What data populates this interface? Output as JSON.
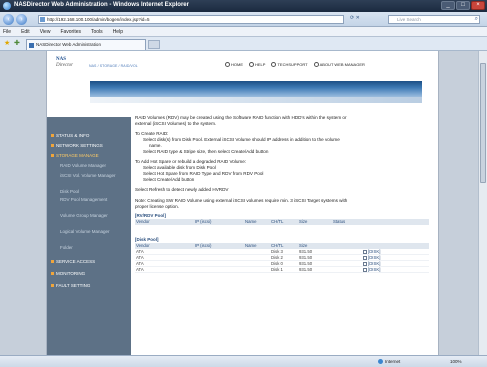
{
  "window": {
    "title": "NASDirector Web Administration - Windows Internet Explorer"
  },
  "nav": {
    "address": "http://192.168.100.100/admin/bogen/index.jsp?id=5",
    "search_placeholder": "Live Search",
    "menu": [
      "File",
      "Edit",
      "View",
      "Favorites",
      "Tools",
      "Help"
    ],
    "tab_title": "NASDirector Web Administration"
  },
  "header": {
    "logo_line1": "NAS",
    "logo_line2": "Director",
    "breadcrumb": "NAS / STORAGE / RAID/VOL",
    "links": [
      "HOME",
      "HELP",
      "TECHSUPPORT",
      "ABOUT WEB MANAGER"
    ]
  },
  "sidebar": {
    "items": [
      {
        "label": "STATUS & INFO",
        "hot": false
      },
      {
        "label": "NETWORK SETTINGS",
        "hot": false
      },
      {
        "label": "STORAGE MANAGE",
        "hot": true
      }
    ],
    "subitems": [
      "RAID Volume Manager",
      "iSCSI Vol. Volume Manager",
      "Disk Pool",
      "RDV Pool Management",
      "Volume Group Manager",
      "Logical Volume Manager",
      "Folder"
    ],
    "bottom_items": [
      "SERVICE ACCESS",
      "MONITORING",
      "FAULT SETTING"
    ]
  },
  "content": {
    "intro1": "RAID Volumes (RDV) may be created using the Software RAID function with HDD's within the system or",
    "intro2": "external (iSCSI Volumes) to the system.",
    "create_head": "To Create RAID:",
    "create_1": "Select disk(s) from Disk Pool. External iSCSI Volume should IP address in addition to the volume",
    "create_1b": "name.",
    "create_2": "Select RAID type & Stripe size, then select Create/Add button",
    "hot_head": "To Add Hot Spare or rebuild a degraded RAID Volume:",
    "hot_1": "Select available disk from Disk Pool",
    "hot_2": "Select Hot Spare from RAID Type and RDV from RDV Pool",
    "hot_3": "Select Create/Add button",
    "refresh": "Select Refresh to detect newly added HVRDV",
    "note": "Note: Creating SW RAID Volume using external iSCSI volumes require min. 3 iSCSI Target systems with",
    "note2": "proper license option."
  },
  "rdv_pool": {
    "caption": "[RV/RDV Pool]",
    "columns": [
      "Vendor",
      "IP (iscsi)",
      "Name",
      "CH/TL",
      "Size",
      "Status"
    ]
  },
  "disk_pool": {
    "caption": "[Disk Pool]",
    "columns": [
      "Vendor",
      "IP (iscsi)",
      "Name",
      "CH/TL",
      "Size"
    ],
    "rows": [
      {
        "vendor": "ATA",
        "ch": "Disk 3",
        "size": "931.50",
        "flag": "[DISK]"
      },
      {
        "vendor": "ATA",
        "ch": "Disk 2",
        "size": "931.50",
        "flag": "[DISK]"
      },
      {
        "vendor": "ATA",
        "ch": "Disk 0",
        "size": "931.50",
        "flag": "[DISK]"
      },
      {
        "vendor": "ATA",
        "ch": "Disk 1",
        "size": "931.50",
        "flag": "[DISK]"
      }
    ]
  },
  "status": {
    "zone": "Internet",
    "zoom": "100%"
  }
}
